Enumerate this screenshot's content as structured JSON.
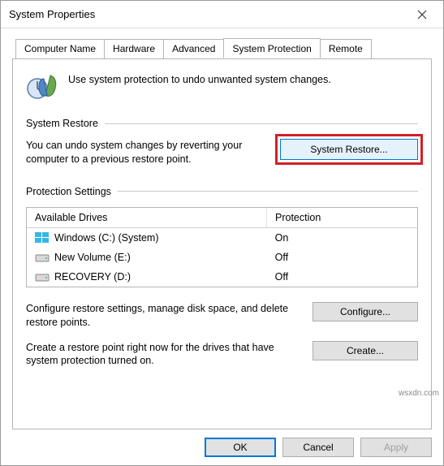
{
  "window": {
    "title": "System Properties"
  },
  "tabs": {
    "items": [
      {
        "label": "Computer Name"
      },
      {
        "label": "Hardware"
      },
      {
        "label": "Advanced"
      },
      {
        "label": "System Protection"
      },
      {
        "label": "Remote"
      }
    ],
    "active_index": 3
  },
  "intro": "Use system protection to undo unwanted system changes.",
  "restore_group": {
    "title": "System Restore",
    "text": "You can undo system changes by reverting your computer to a previous restore point.",
    "button": "System Restore..."
  },
  "protection_group": {
    "title": "Protection Settings",
    "columns": {
      "drive": "Available Drives",
      "protection": "Protection"
    },
    "drives": [
      {
        "name": "Windows (C:) (System)",
        "protection": "On",
        "icon": "windows"
      },
      {
        "name": "New Volume (E:)",
        "protection": "Off",
        "icon": "disk"
      },
      {
        "name": "RECOVERY (D:)",
        "protection": "Off",
        "icon": "disk"
      }
    ],
    "configure_text": "Configure restore settings, manage disk space, and delete restore points.",
    "configure_button": "Configure...",
    "create_text": "Create a restore point right now for the drives that have system protection turned on.",
    "create_button": "Create..."
  },
  "footer": {
    "ok": "OK",
    "cancel": "Cancel",
    "apply": "Apply"
  },
  "watermark": "wsxdn.com"
}
